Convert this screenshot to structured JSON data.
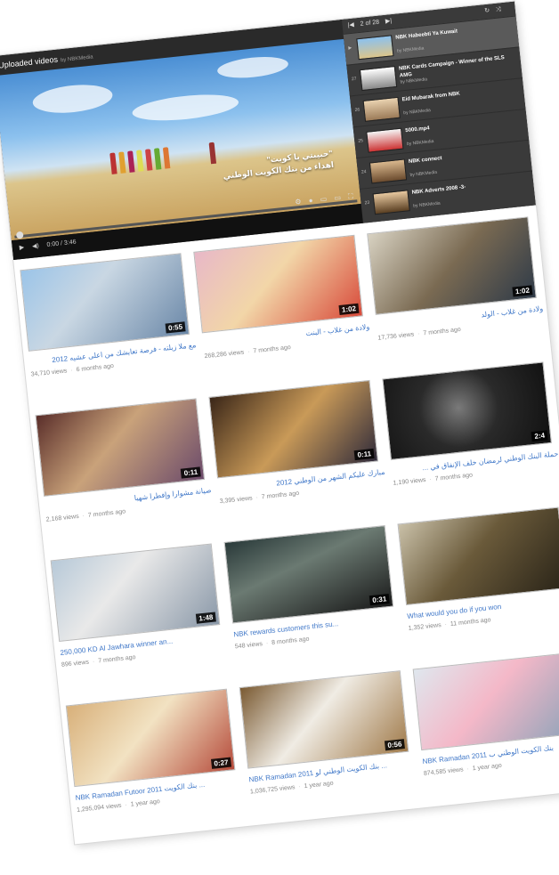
{
  "player": {
    "header_title": "Uploaded videos",
    "header_by": "by NBKMedia",
    "overlay_line1": "\"حبيبتي يا كويت\"",
    "overlay_line2": "اهداء من بنك الكويت الوطني",
    "time": "0:00 / 3:46"
  },
  "playlist": {
    "header_counter": "2 of 28",
    "items": [
      {
        "num": "",
        "title": "NBK Habeebti Ya Kuwait",
        "by": "by NBKMedia",
        "active": true
      },
      {
        "num": "27",
        "title": "NBK Cards Campaign - Winner of the SLS AMG",
        "by": "by NBKMedia"
      },
      {
        "num": "26",
        "title": "Eid Mubarak from NBK",
        "by": "by NBKMedia"
      },
      {
        "num": "25",
        "title": "5000.mp4",
        "by": "by NBKMedia"
      },
      {
        "num": "24",
        "title": "NBK connect",
        "by": "by NBKMedia"
      },
      {
        "num": "23",
        "title": "NBK Adverts 2008 -3-",
        "by": "by NBKMedia"
      }
    ]
  },
  "videos": [
    {
      "title": "مع ملا زيلته - فرصة تعايشك من اعلى عشيه 2012",
      "views": "34,710 views",
      "age": "6 months ago",
      "duration": "0:55"
    },
    {
      "title": "ولادة من غلاب - البنت",
      "views": "268,286 views",
      "age": "7 months ago",
      "duration": "1:02"
    },
    {
      "title": "ولادة من غلاب - الولد",
      "views": "17,736 views",
      "age": "7 months ago",
      "duration": "1:02"
    },
    {
      "title": "صيانة مشوارا وإفطرا شهيا",
      "views": "2,168 views",
      "age": "7 months ago",
      "duration": "0:11"
    },
    {
      "title": "مبارك عليكم الشهر من الوطني 2012",
      "views": "3,395 views",
      "age": "7 months ago",
      "duration": "0:11"
    },
    {
      "title": "حملة البنك الوطني لرمضان خلف الإنفاق في ...",
      "views": "1,190 views",
      "age": "7 months ago",
      "duration": "2:4"
    },
    {
      "title": "250,000 KD Al Jawhara winner an...",
      "views": "896 views",
      "age": "7 months ago",
      "duration": "1:48"
    },
    {
      "title": "NBK rewards customers this su...",
      "views": "548 views",
      "age": "8 months ago",
      "duration": "0:31"
    },
    {
      "title": "What would you do if you won",
      "views": "1,352 views",
      "age": "11 months ago",
      "duration": ""
    },
    {
      "title": "NBK Ramadan Futoor 2011 بنك الكويت ...",
      "views": "1,295,094 views",
      "age": "1 year ago",
      "duration": "0:27"
    },
    {
      "title": "NBK Ramadan 2011 بنك الكويت الوطني لو ...",
      "views": "1,036,725 views",
      "age": "1 year ago",
      "duration": "0:56"
    },
    {
      "title": "NBK Ramadan 2011 بنك الكويت الوطني ب",
      "views": "874,585 views",
      "age": "1 year ago",
      "duration": ""
    }
  ]
}
